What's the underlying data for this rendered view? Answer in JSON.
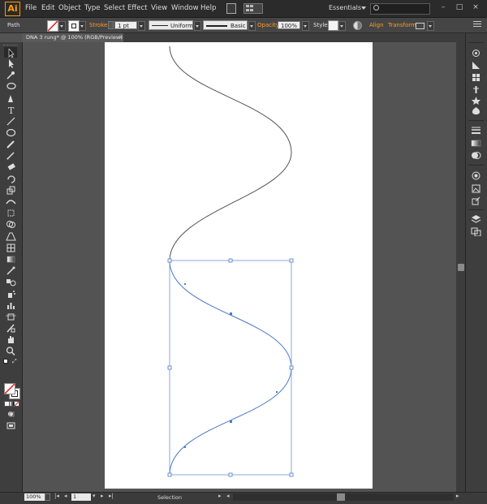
{
  "app": {
    "logo": "Ai"
  },
  "menu": [
    "File",
    "Edit",
    "Object",
    "Type",
    "Select",
    "Effect",
    "View",
    "Window",
    "Help"
  ],
  "workspace": "Essentials",
  "search": {
    "placeholder": ""
  },
  "controlbar": {
    "selection_type": "Path",
    "stroke_label": "Stroke",
    "stroke_weight": "1 pt",
    "profile": "Uniform",
    "brush": "Basic",
    "opacity_label": "Opacity",
    "opacity_value": "100%",
    "style_label": "Style",
    "align_label": "Align",
    "transform_label": "Transform"
  },
  "document_tab": {
    "title": "DNA 3 rung* @ 100% (RGB/Preview)",
    "close": "×"
  },
  "statusbar": {
    "zoom": "100%",
    "page": "1",
    "status": "Selection"
  },
  "colors": {
    "accent": "#ff9d1f",
    "selection": "#4a78c9",
    "artboard": "#ffffff",
    "pasteboard": "#535353"
  }
}
